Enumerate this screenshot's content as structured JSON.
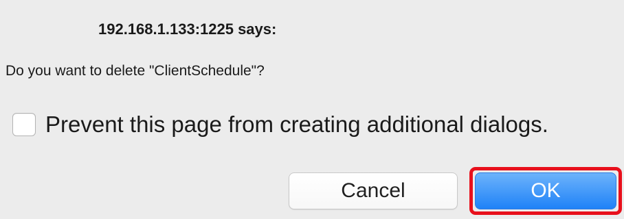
{
  "dialog": {
    "title": "192.168.1.133:1225 says:",
    "message": "Do you want to delete \"ClientSchedule\"?",
    "prevent_checkbox": {
      "label": "Prevent this page from creating additional dialogs.",
      "checked": false
    },
    "buttons": {
      "cancel_label": "Cancel",
      "ok_label": "OK"
    }
  },
  "colors": {
    "dialog_background": "#ececec",
    "ok_button": "#1f82f7",
    "highlight_outline": "#e8101c"
  }
}
